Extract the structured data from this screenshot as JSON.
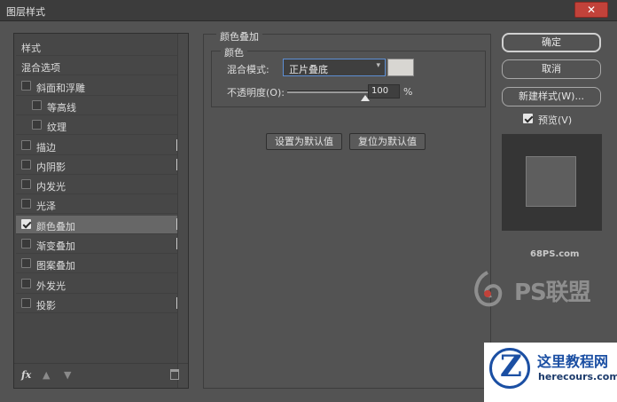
{
  "window": {
    "title": "图层样式",
    "close_glyph": "✕"
  },
  "left_panel": {
    "items": [
      {
        "label": "样式",
        "checkbox": false,
        "checked": false,
        "plus": false,
        "indent": false,
        "selected": false
      },
      {
        "label": "混合选项",
        "checkbox": false,
        "checked": false,
        "plus": false,
        "indent": false,
        "selected": false
      },
      {
        "label": "斜面和浮雕",
        "checkbox": true,
        "checked": false,
        "plus": false,
        "indent": false,
        "selected": false
      },
      {
        "label": "等高线",
        "checkbox": true,
        "checked": false,
        "plus": false,
        "indent": true,
        "selected": false
      },
      {
        "label": "纹理",
        "checkbox": true,
        "checked": false,
        "plus": false,
        "indent": true,
        "selected": false
      },
      {
        "label": "描边",
        "checkbox": true,
        "checked": false,
        "plus": true,
        "indent": false,
        "selected": false
      },
      {
        "label": "内阴影",
        "checkbox": true,
        "checked": false,
        "plus": true,
        "indent": false,
        "selected": false
      },
      {
        "label": "内发光",
        "checkbox": true,
        "checked": false,
        "plus": false,
        "indent": false,
        "selected": false
      },
      {
        "label": "光泽",
        "checkbox": true,
        "checked": false,
        "plus": false,
        "indent": false,
        "selected": false
      },
      {
        "label": "颜色叠加",
        "checkbox": true,
        "checked": true,
        "plus": true,
        "indent": false,
        "selected": true
      },
      {
        "label": "渐变叠加",
        "checkbox": true,
        "checked": false,
        "plus": true,
        "indent": false,
        "selected": false
      },
      {
        "label": "图案叠加",
        "checkbox": true,
        "checked": false,
        "plus": false,
        "indent": false,
        "selected": false
      },
      {
        "label": "外发光",
        "checkbox": true,
        "checked": false,
        "plus": false,
        "indent": false,
        "selected": false
      },
      {
        "label": "投影",
        "checkbox": true,
        "checked": false,
        "plus": true,
        "indent": false,
        "selected": false
      }
    ],
    "footer": {
      "fx_label": "fx",
      "up_glyph": "▲",
      "down_glyph": "▼"
    }
  },
  "color_overlay": {
    "group_title": "颜色叠加",
    "sub_title": "颜色",
    "blend_label": "混合模式:",
    "blend_value": "正片叠底",
    "blend_chevron": "▾",
    "swatch_color": "#d8d6d2",
    "opacity_label": "不透明度(O):",
    "opacity_value": "100",
    "opacity_unit": "%",
    "opacity_fraction": 1.0,
    "set_default": "设置为默认值",
    "reset_default": "复位为默认值"
  },
  "right_panel": {
    "ok": "确定",
    "cancel": "取消",
    "new_style": "新建样式(W)...",
    "preview_label": "预览(V)",
    "preview_checked": true
  },
  "watermark": {
    "domain": "68PS.com",
    "brand": "PS联盟"
  },
  "badge": {
    "letter": "Z",
    "title": "这里教程网",
    "url": "herecours.com"
  },
  "colors": {
    "accent_focus": "#5d8ed3",
    "close_red": "#c2423a",
    "badge_blue": "#1b4fa3"
  }
}
